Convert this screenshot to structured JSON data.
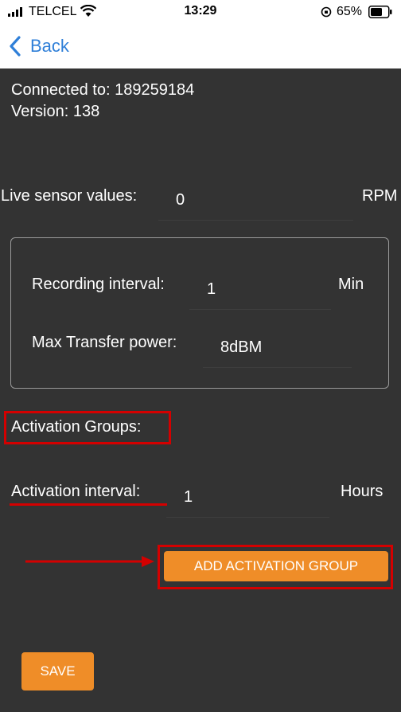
{
  "status_bar": {
    "carrier": "TELCEL",
    "time": "13:29",
    "battery_percent": "65%",
    "icons": [
      "signal-bars-icon",
      "wifi-icon",
      "orientation-lock-icon",
      "battery-icon"
    ]
  },
  "nav": {
    "back_label": "Back",
    "accent_color": "#2f7fd8"
  },
  "device": {
    "connected_line": "Connected to: 189259184",
    "version_line": "Version: 138"
  },
  "live_sensor": {
    "label": "Live sensor values:",
    "value": "0",
    "unit": "RPM"
  },
  "settings": {
    "recording_label": "Recording interval:",
    "recording_value": "1",
    "recording_unit": "Min",
    "power_label": "Max Transfer power:",
    "power_value": "8dBM"
  },
  "activation": {
    "groups_label": "Activation Groups:",
    "interval_label": "Activation interval:",
    "interval_value": "1",
    "interval_unit": "Hours",
    "add_button_label": "ADD ACTIVATION GROUP"
  },
  "footer": {
    "save_label": "SAVE"
  },
  "colors": {
    "background": "#333333",
    "button": "#ef8d28",
    "annotation": "#d40000"
  }
}
